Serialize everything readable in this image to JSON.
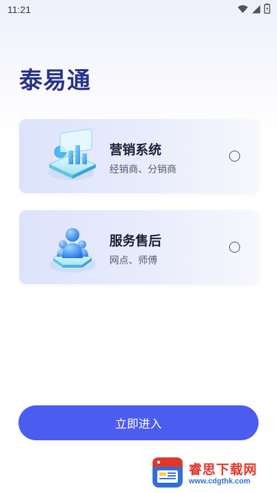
{
  "status_bar": {
    "time": "11:21"
  },
  "app": {
    "title": "泰易通"
  },
  "cards": [
    {
      "title": "营销系统",
      "subtitle": "经销商、分销商",
      "icon": "analytics-dashboard-illustration"
    },
    {
      "title": "服务售后",
      "subtitle": "网点、师傅",
      "icon": "user-service-illustration"
    }
  ],
  "enter_button": {
    "label": "立即进入"
  },
  "watermark": {
    "name": "睿思下载网",
    "url": "www.cdgthk.com"
  },
  "colors": {
    "accent": "#4b5cf0",
    "title": "#26338a",
    "watermark_red": "#e0372c",
    "watermark_blue": "#2f6fd8"
  }
}
